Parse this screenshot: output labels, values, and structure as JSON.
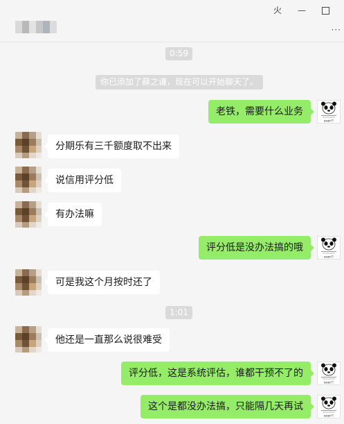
{
  "window": {
    "controls": {
      "pin": "⽕",
      "minimize": "—",
      "maximize": "☐",
      "close": "✕"
    },
    "more": "···"
  },
  "colors": {
    "outgoing_bubble": "#95ec69",
    "incoming_bubble": "#ffffff",
    "background": "#f5f5f5",
    "timestamp_bg": "#dadada"
  },
  "chat": {
    "timestamps": [
      "0:59",
      "1:01"
    ],
    "system_notice": "你已添加了薛之谦，现在可以开始聊天了。",
    "messages": [
      {
        "side": "out",
        "text": "老铁，需要什么业务"
      },
      {
        "side": "in",
        "text": "分期乐有三千额度取不出来"
      },
      {
        "side": "in",
        "text": "说信用评分低"
      },
      {
        "side": "in",
        "text": "有办法嘛"
      },
      {
        "side": "out",
        "text": "评分低是没办法搞的哦"
      },
      {
        "side": "in",
        "text": "可是我这个月按时还了"
      },
      {
        "side": "in",
        "text": "他还是一直那么说很难受"
      },
      {
        "side": "out",
        "text": "评分低，这是系统评估，谁都干预不了的"
      },
      {
        "side": "out",
        "text": "这个是都没办法搞，只能隔几天再试"
      }
    ]
  },
  "avatars": {
    "contact_icon": "blurred-contact-avatar",
    "self_icon": "panda-meme-avatar",
    "self_caption": "ever!!"
  }
}
